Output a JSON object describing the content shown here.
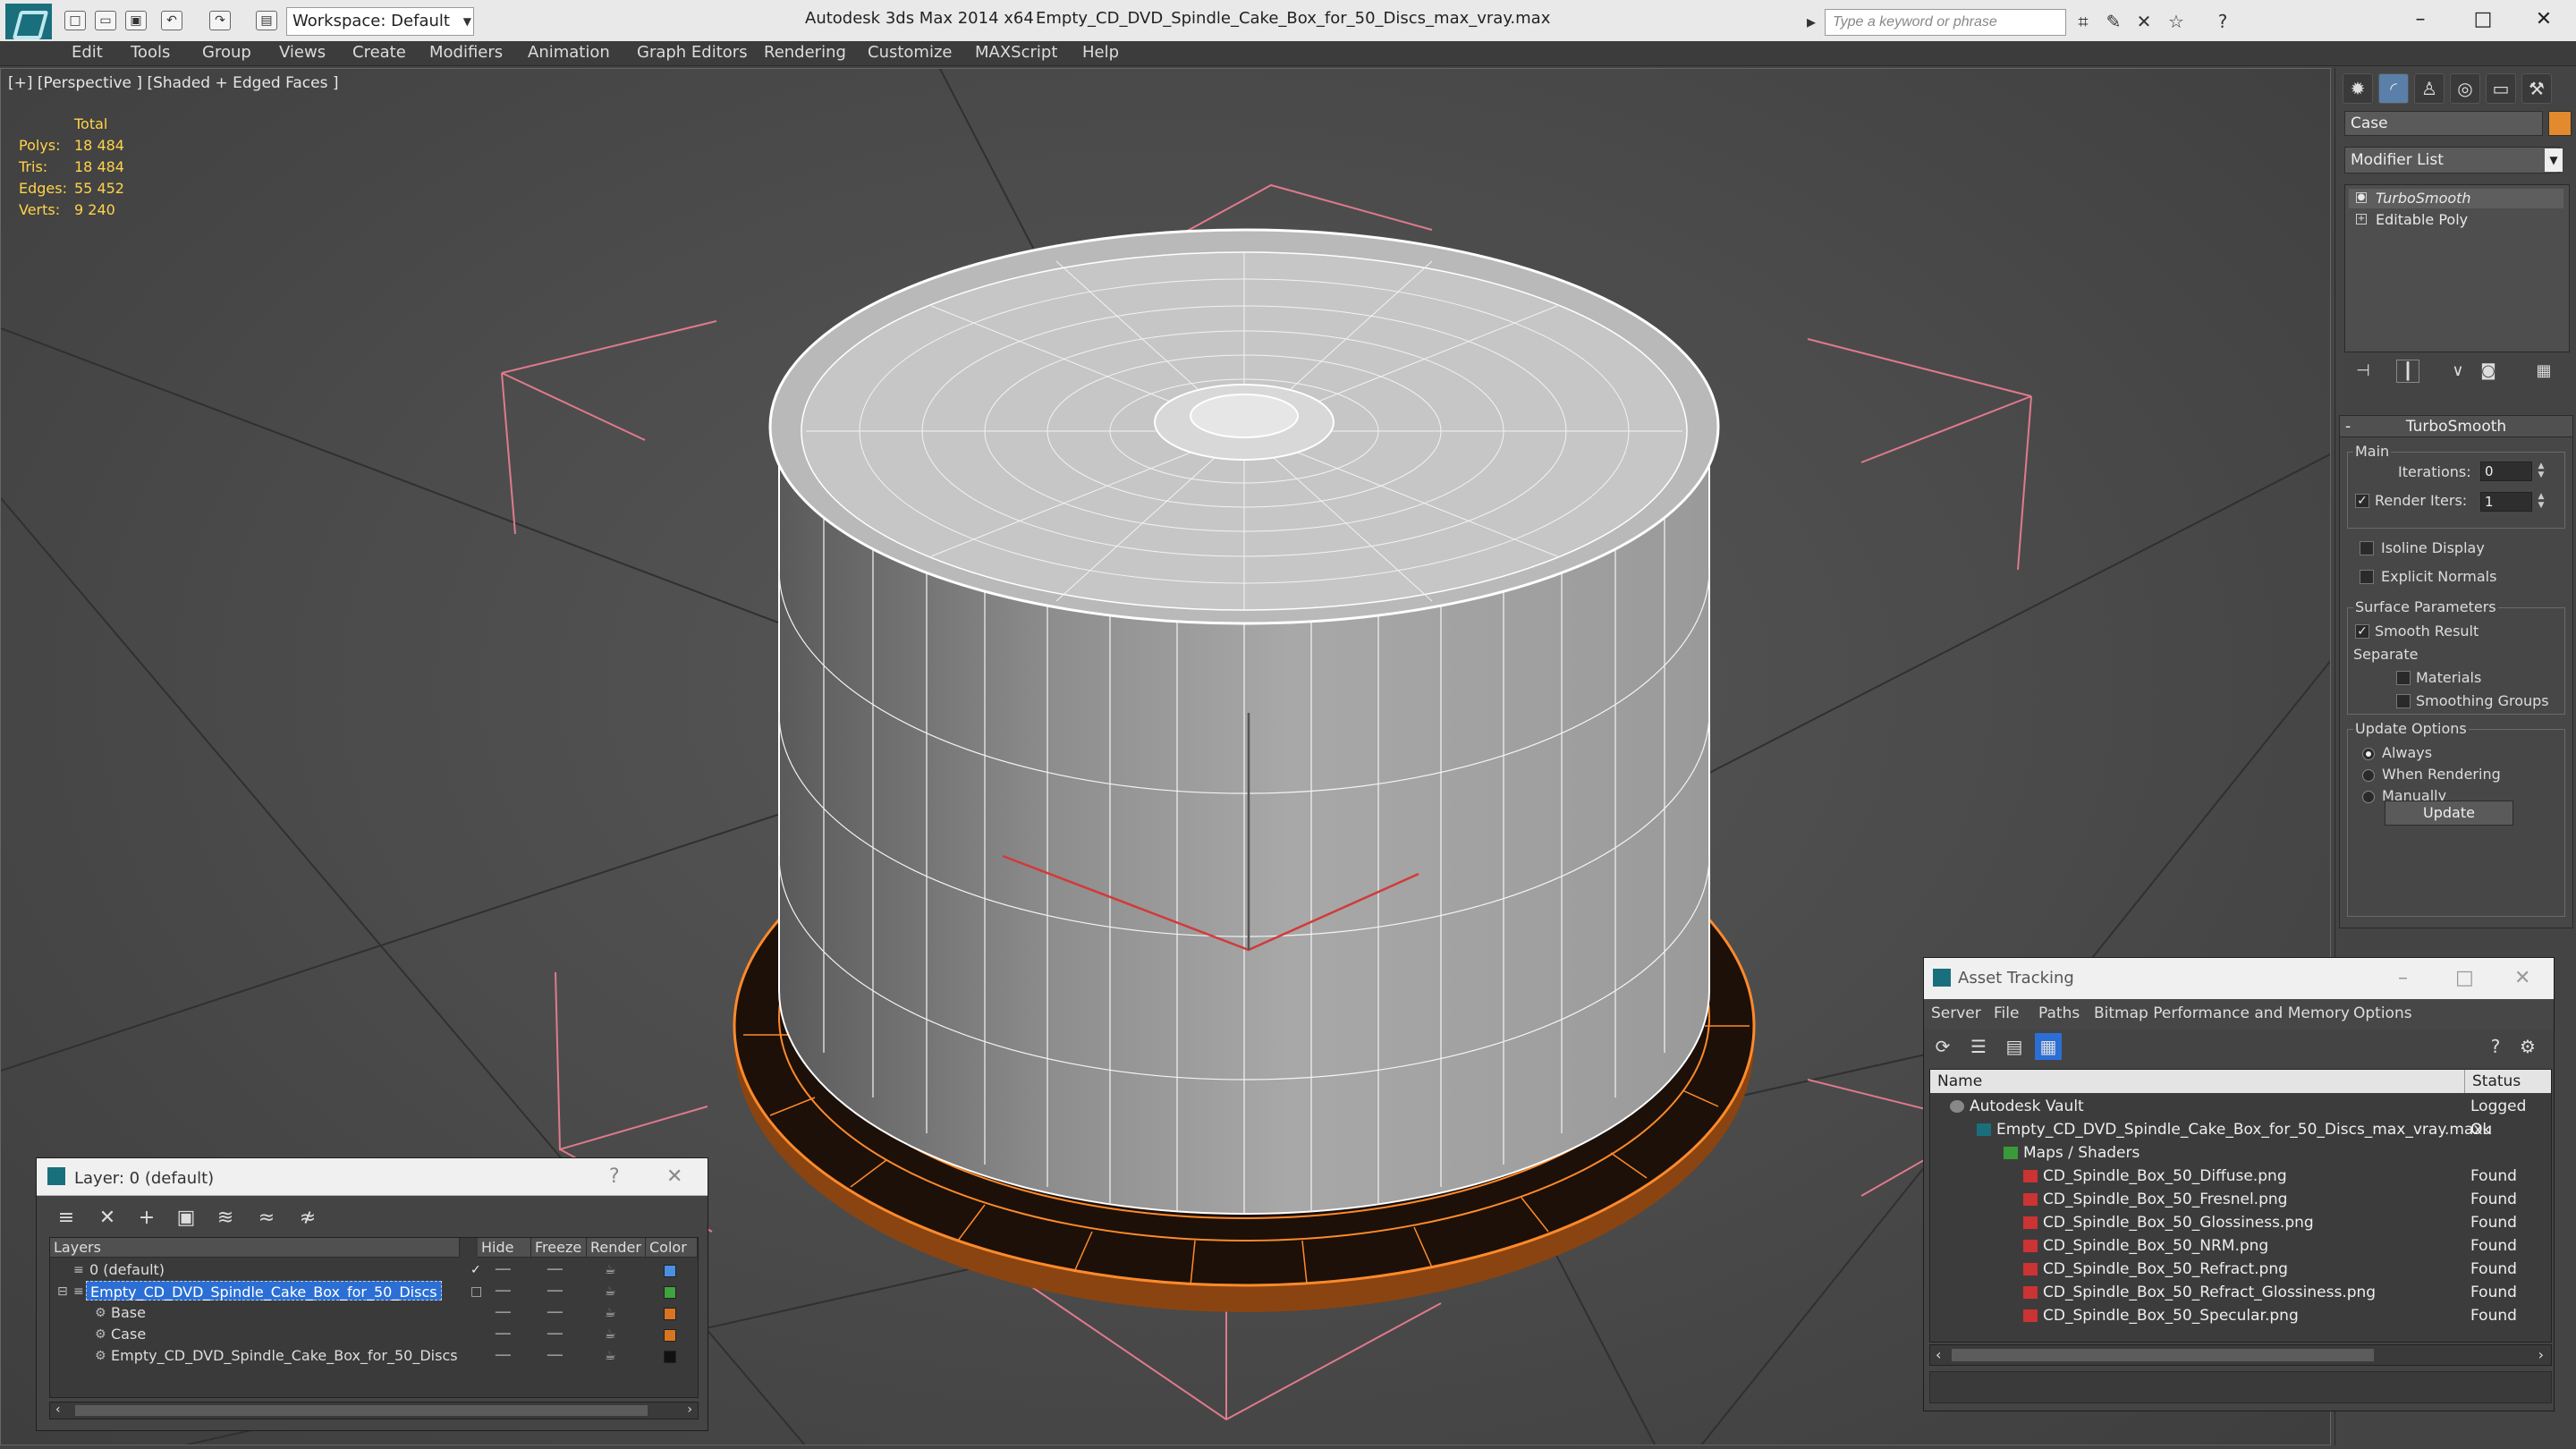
{
  "window": {
    "app_title": "Autodesk 3ds Max  2014 x64",
    "file_title": "Empty_CD_DVD_Spindle_Cake_Box_for_50_Discs_max_vray.max",
    "workspace": "Workspace: Default",
    "search_placeholder": "Type a keyword or phrase",
    "brand_color": "#1a6f7d"
  },
  "menu": [
    "Edit",
    "Tools",
    "Group",
    "Views",
    "Create",
    "Modifiers",
    "Animation",
    "Graph Editors",
    "Rendering",
    "Customize",
    "MAXScript",
    "Help"
  ],
  "viewport": {
    "label": "[+] [Perspective ] [Shaded + Edged Faces ]",
    "stats": {
      "header": "Total",
      "rows": [
        {
          "label": "Polys:",
          "value": "18 484"
        },
        {
          "label": "Tris:",
          "value": "18 484"
        },
        {
          "label": "Edges:",
          "value": "55 452"
        },
        {
          "label": "Verts:",
          "value": "9 240"
        }
      ]
    }
  },
  "command_panel": {
    "object_name": "Case",
    "object_color": "#e38a2e",
    "modifier_list": "Modifier List",
    "stack": [
      "TurboSmooth",
      "Editable Poly"
    ],
    "rollout": {
      "title": "TurboSmooth",
      "main_group": "Main",
      "iterations_label": "Iterations:",
      "iterations_value": "0",
      "render_iters_label": "Render Iters:",
      "render_iters_value": "1",
      "isoline": "Isoline Display",
      "explicit_normals": "Explicit Normals",
      "surface_group": "Surface Parameters",
      "smooth_result": "Smooth Result",
      "separate": "Separate",
      "materials": "Materials",
      "smoothing_groups": "Smoothing Groups",
      "update_group": "Update Options",
      "always": "Always",
      "when_rendering": "When Rendering",
      "manually": "Manually",
      "update_button": "Update"
    }
  },
  "layer_window": {
    "title": "Layer: 0 (default)",
    "help": "?",
    "columns": [
      "Layers",
      "Hide",
      "Freeze",
      "Render",
      "Color"
    ],
    "rows": [
      {
        "name": "0 (default)",
        "color": "#4a90e2",
        "indent": 1
      },
      {
        "name": "Empty_CD_DVD_Spindle_Cake_Box_for_50_Discs",
        "color": "#3fa33f",
        "indent": 1,
        "selected": true
      },
      {
        "name": "Base",
        "color": "#d9741f",
        "indent": 2
      },
      {
        "name": "Case",
        "color": "#d9741f",
        "indent": 2
      },
      {
        "name": "Empty_CD_DVD_Spindle_Cake_Box_for_50_Discs",
        "color": "#111111",
        "indent": 2
      }
    ]
  },
  "asset_window": {
    "title": "Asset Tracking",
    "menu": [
      "Server",
      "File",
      "Paths",
      "Bitmap Performance and Memory",
      "Options"
    ],
    "columns": [
      "Name",
      "Status"
    ],
    "rows": [
      {
        "name": "Autodesk Vault",
        "status": "Logged Ou",
        "indent": 0
      },
      {
        "name": "Empty_CD_DVD_Spindle_Cake_Box_for_50_Discs_max_vray.max",
        "status": "Ok",
        "indent": 1
      },
      {
        "name": "Maps / Shaders",
        "status": "",
        "indent": 2
      },
      {
        "name": "CD_Spindle_Box_50_Diffuse.png",
        "status": "Found",
        "indent": 3
      },
      {
        "name": "CD_Spindle_Box_50_Fresnel.png",
        "status": "Found",
        "indent": 3
      },
      {
        "name": "CD_Spindle_Box_50_Glossiness.png",
        "status": "Found",
        "indent": 3
      },
      {
        "name": "CD_Spindle_Box_50_NRM.png",
        "status": "Found",
        "indent": 3
      },
      {
        "name": "CD_Spindle_Box_50_Refract.png",
        "status": "Found",
        "indent": 3
      },
      {
        "name": "CD_Spindle_Box_50_Refract_Glossiness.png",
        "status": "Found",
        "indent": 3
      },
      {
        "name": "CD_Spindle_Box_50_Specular.png",
        "status": "Found",
        "indent": 3
      }
    ]
  }
}
